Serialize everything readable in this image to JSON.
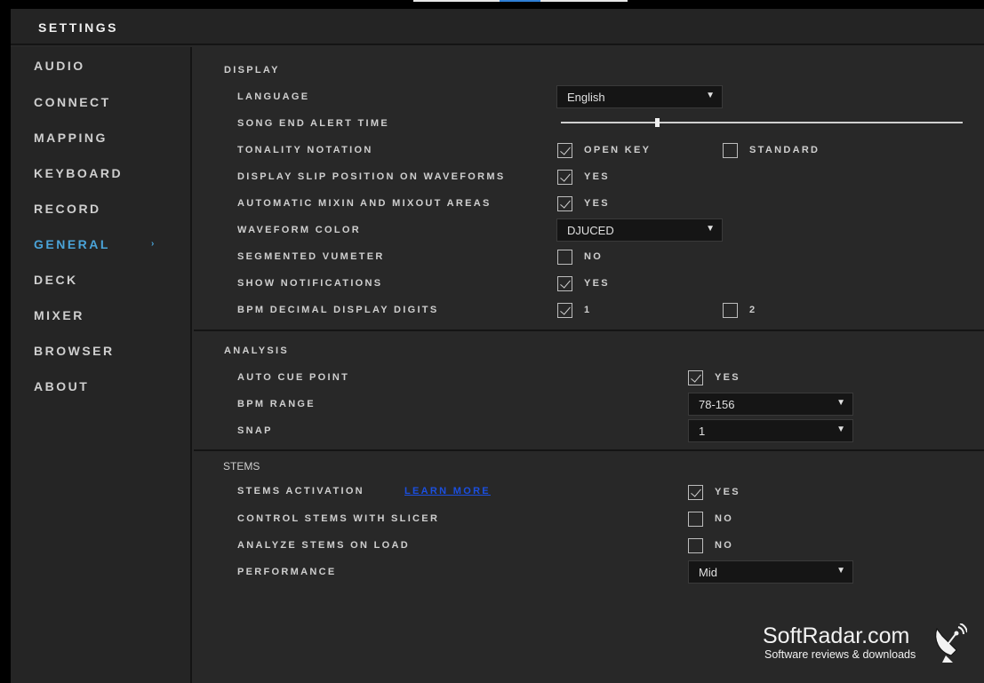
{
  "window": {
    "title": "SETTINGS"
  },
  "sidebar": {
    "items": [
      {
        "label": "AUDIO"
      },
      {
        "label": "CONNECT"
      },
      {
        "label": "MAPPING"
      },
      {
        "label": "KEYBOARD"
      },
      {
        "label": "RECORD"
      },
      {
        "label": "GENERAL",
        "active": true
      },
      {
        "label": "DECK"
      },
      {
        "label": "MIXER"
      },
      {
        "label": "BROWSER"
      },
      {
        "label": "ABOUT"
      }
    ],
    "active_arrow": "›"
  },
  "display": {
    "title": "DISPLAY",
    "language": {
      "label": "LANGUAGE",
      "value": "English"
    },
    "song_end_alert": {
      "label": "SONG END ALERT TIME",
      "level": 0.24
    },
    "tonality": {
      "label": "TONALITY NOTATION",
      "option1": "OPEN KEY",
      "option1_checked": true,
      "option2": "STANDARD",
      "option2_checked": false
    },
    "slip": {
      "label": "DISPLAY SLIP POSITION ON WAVEFORMS",
      "option": "YES",
      "checked": true
    },
    "mixin": {
      "label": "AUTOMATIC MIXIN AND MIXOUT AREAS",
      "option": "YES",
      "checked": true
    },
    "waveform_color": {
      "label": "WAVEFORM COLOR",
      "value": "DJUCED"
    },
    "vumeter": {
      "label": "SEGMENTED VUMETER",
      "option": "NO",
      "checked": false
    },
    "notifications": {
      "label": "SHOW NOTIFICATIONS",
      "option": "YES",
      "checked": true
    },
    "bpm_digits": {
      "label": "BPM DECIMAL DISPLAY DIGITS",
      "option1": "1",
      "option1_checked": true,
      "option2": "2",
      "option2_checked": false
    }
  },
  "analysis": {
    "title": "ANALYSIS",
    "auto_cue": {
      "label": "AUTO CUE POINT",
      "option": "YES",
      "checked": true
    },
    "bpm_range": {
      "label": "BPM RANGE",
      "value": "78-156"
    },
    "snap": {
      "label": "SNAP",
      "value": "1"
    }
  },
  "stems": {
    "title": "STEMS",
    "activation": {
      "label": "STEMS ACTIVATION",
      "link": "LEARN MORE",
      "option": "YES",
      "checked": true
    },
    "slicer": {
      "label": "CONTROL STEMS WITH SLICER",
      "option": "NO",
      "checked": false
    },
    "analyze": {
      "label": "ANALYZE STEMS ON LOAD",
      "option": "NO",
      "checked": false
    },
    "performance": {
      "label": "PERFORMANCE",
      "value": "Mid"
    }
  },
  "watermark": {
    "name": "SoftRadar.com",
    "tagline": "Software reviews & downloads"
  },
  "icons": {
    "dropdown": "▼"
  },
  "colors": {
    "accent": "#4aa3d8",
    "background": "#282828",
    "link": "#1b4fe0"
  }
}
